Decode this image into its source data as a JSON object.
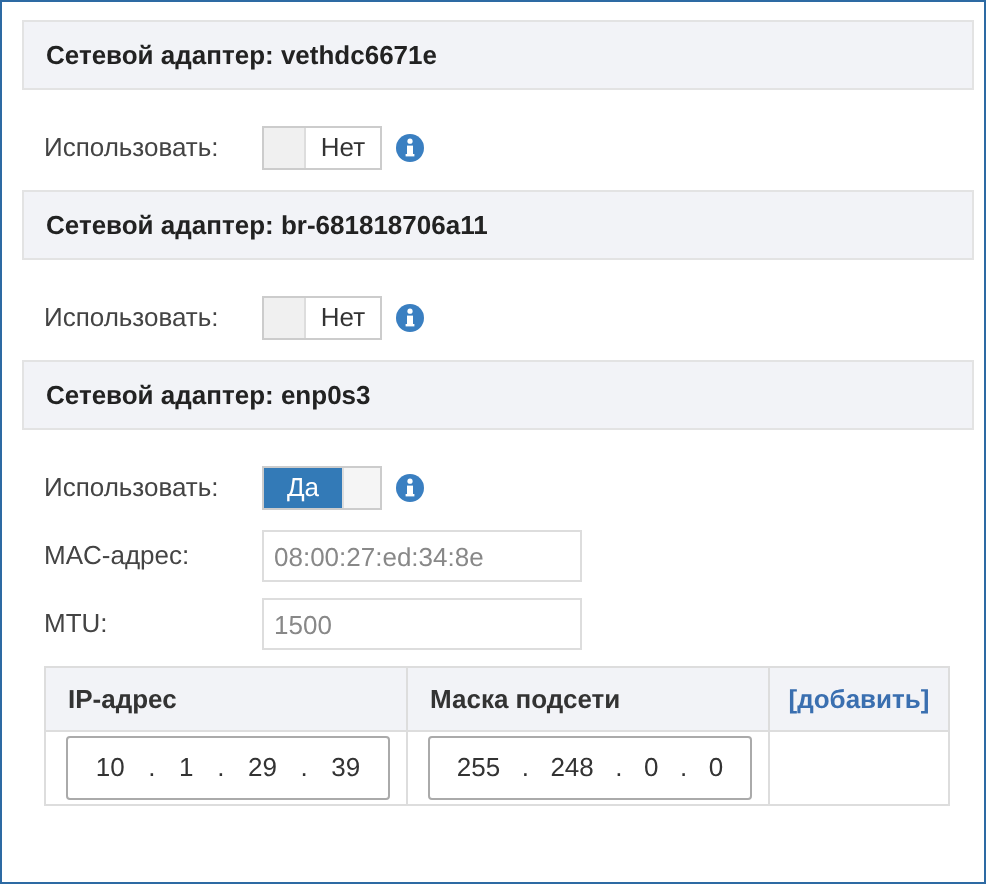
{
  "adapters": [
    {
      "title": "Сетевой адаптер: vethdc6671e",
      "use_label": "Использовать:",
      "toggle": {
        "on": false,
        "label": "Нет"
      }
    },
    {
      "title": "Сетевой адаптер: br-681818706a11",
      "use_label": "Использовать:",
      "toggle": {
        "on": false,
        "label": "Нет"
      }
    },
    {
      "title": "Сетевой адаптер: enp0s3",
      "use_label": "Использовать:",
      "toggle": {
        "on": true,
        "label": "Да"
      },
      "fields": [
        {
          "label": "MAC-адрес:",
          "placeholder": "08:00:27:ed:34:8e"
        },
        {
          "label": "MTU:",
          "placeholder": "1500"
        }
      ],
      "table": {
        "columns": [
          "IP-адрес",
          "Маска подсети"
        ],
        "add_link": "[добавить]",
        "rows": [
          {
            "ip": [
              "10",
              ".",
              "1",
              ".",
              "29",
              ".",
              "39"
            ],
            "mask": [
              "255",
              ".",
              "248",
              ".",
              "0",
              ".",
              "0"
            ]
          }
        ]
      }
    }
  ]
}
